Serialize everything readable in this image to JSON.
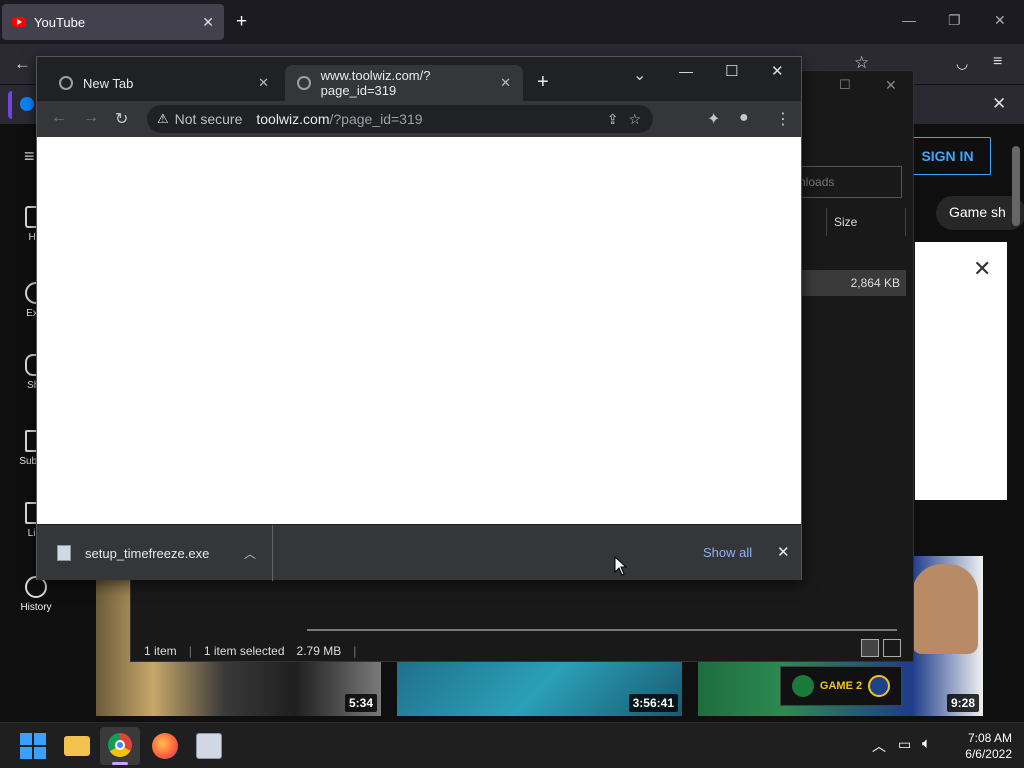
{
  "firefox": {
    "tab_title": "YouTube",
    "new_tab_symbol": "+",
    "close_symbol": "✕"
  },
  "youtube": {
    "sidebar": [
      {
        "label": "Hoi",
        "icon": "home-icon"
      },
      {
        "label": "Expl",
        "icon": "explore-icon"
      },
      {
        "label": "Sho",
        "icon": "shorts-icon"
      },
      {
        "label": "Subscri",
        "icon": "subscriptions-icon"
      },
      {
        "label": "Libr",
        "icon": "library-icon"
      },
      {
        "label": "History",
        "icon": "history-icon"
      }
    ],
    "sign_in": "SIGN IN",
    "chip": "Game sh",
    "videos": [
      {
        "duration": "5:34"
      },
      {
        "duration": "3:56:41"
      },
      {
        "duration": "9:28"
      }
    ],
    "badge": "GAME 2"
  },
  "explorer": {
    "search_placeholder": "nloads",
    "column_size": "Size",
    "file_size": "2,864 KB",
    "status": {
      "items": "1 item",
      "selected": "1 item selected",
      "size": "2.79 MB"
    }
  },
  "chrome": {
    "tabs": [
      {
        "title": "New Tab",
        "active": false
      },
      {
        "title": "www.toolwiz.com/?page_id=319",
        "active": true
      }
    ],
    "new_tab": "+",
    "address": {
      "security": "Not secure",
      "host": "toolwiz.com",
      "path": "/?page_id=319"
    },
    "download": {
      "filename": "setup_timefreeze.exe",
      "show_all": "Show all"
    },
    "window_controls": {
      "minimize": "—",
      "maximize": "☐",
      "close": "✕",
      "tabsearch": "⌄"
    }
  },
  "taskbar": {
    "time": "7:08 AM",
    "date": "6/6/2022",
    "apps": [
      "start",
      "file-explorer",
      "chrome",
      "firefox",
      "setup"
    ]
  },
  "colors": {
    "accent_link": "#8ab4f8",
    "youtube_signin": "#3ea6ff",
    "youtube_red": "#ff0000"
  }
}
